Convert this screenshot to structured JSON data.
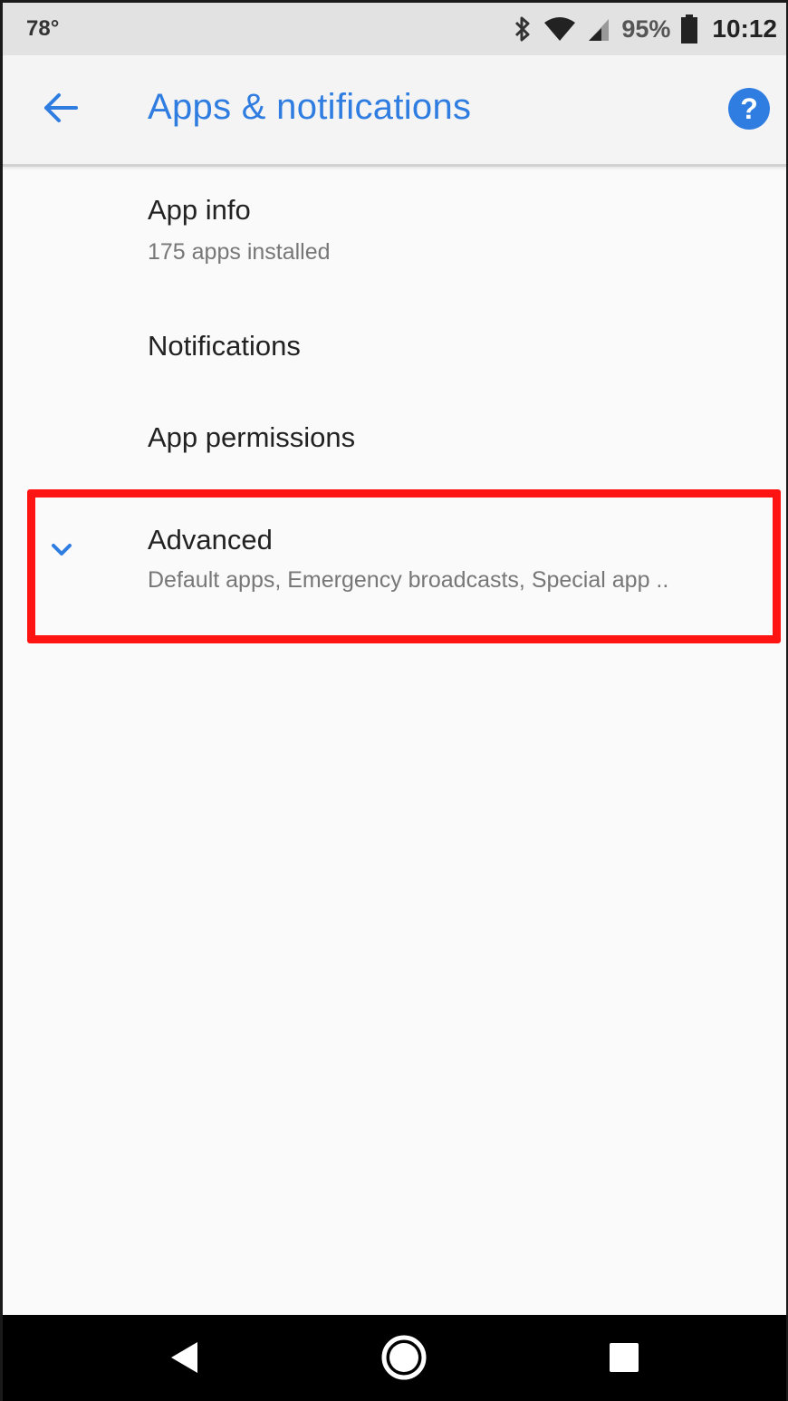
{
  "status_bar": {
    "temperature": "78°",
    "battery_percent": "95%",
    "time": "10:12",
    "icons": [
      "bluetooth-icon",
      "wifi-icon",
      "cell-signal-icon",
      "battery-icon"
    ]
  },
  "app_bar": {
    "title": "Apps & notifications",
    "back_icon": "arrow-back-icon",
    "help_icon": "help-icon",
    "help_glyph": "?"
  },
  "list": {
    "items": [
      {
        "title": "App info",
        "subtitle": "175 apps installed"
      },
      {
        "title": "Notifications"
      },
      {
        "title": "App permissions"
      },
      {
        "title": "Advanced",
        "subtitle": "Default apps, Emergency broadcasts, Special app ..",
        "icon": "chevron-down-icon",
        "highlighted": true
      }
    ]
  },
  "nav_bar": {
    "icons": [
      "nav-back-icon",
      "nav-home-icon",
      "nav-recent-icon"
    ]
  },
  "colors": {
    "accent": "#2f7de1",
    "highlight": "#ff1414",
    "status_bar_bg": "#e2e2e2",
    "app_bar_bg": "#f4f4f4",
    "content_bg": "#fafafa",
    "nav_bar_bg": "#000000"
  }
}
